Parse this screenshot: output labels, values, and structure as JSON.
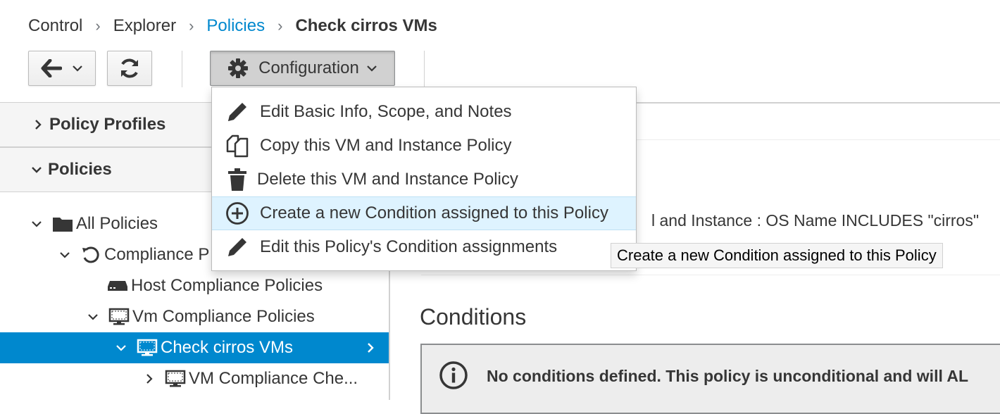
{
  "breadcrumb": [
    "Control",
    "Explorer",
    "Policies",
    "Check cirros VMs"
  ],
  "toolbar": {
    "configuration_label": "Configuration"
  },
  "menu": {
    "items": [
      {
        "label": "Edit Basic Info, Scope, and Notes",
        "icon": "pencil-icon"
      },
      {
        "label": "Copy this VM and Instance Policy",
        "icon": "copy-icon"
      },
      {
        "label": "Delete this VM and Instance Policy",
        "icon": "trash-icon"
      },
      {
        "label": "Create a new Condition assigned to this Policy",
        "icon": "plus-circle-icon"
      },
      {
        "label": "Edit this Policy's Condition assignments",
        "icon": "pencil-icon"
      }
    ]
  },
  "tooltip": "Create a new Condition assigned to this Policy",
  "accordion": {
    "policy_profiles": "Policy Profiles",
    "policies": "Policies"
  },
  "tree": [
    {
      "label": "All Policies"
    },
    {
      "label": "Compliance Policies",
      "visible": "Compliance P"
    },
    {
      "label": "Host Compliance Policies"
    },
    {
      "label": "Vm Compliance Policies"
    },
    {
      "label": "Check cirros VMs",
      "selected": true
    },
    {
      "label": "VM Compliance Che..."
    }
  ],
  "main": {
    "expression_visible": "l and Instance : OS Name INCLUDES \"cirros\"",
    "conditions_title": "Conditions",
    "no_conditions_text": "No conditions defined. This policy is unconditional and will AL"
  },
  "colors": {
    "accent": "#0088ce",
    "selected_row": "#0088ce",
    "menu_hover": "#def3ff"
  }
}
